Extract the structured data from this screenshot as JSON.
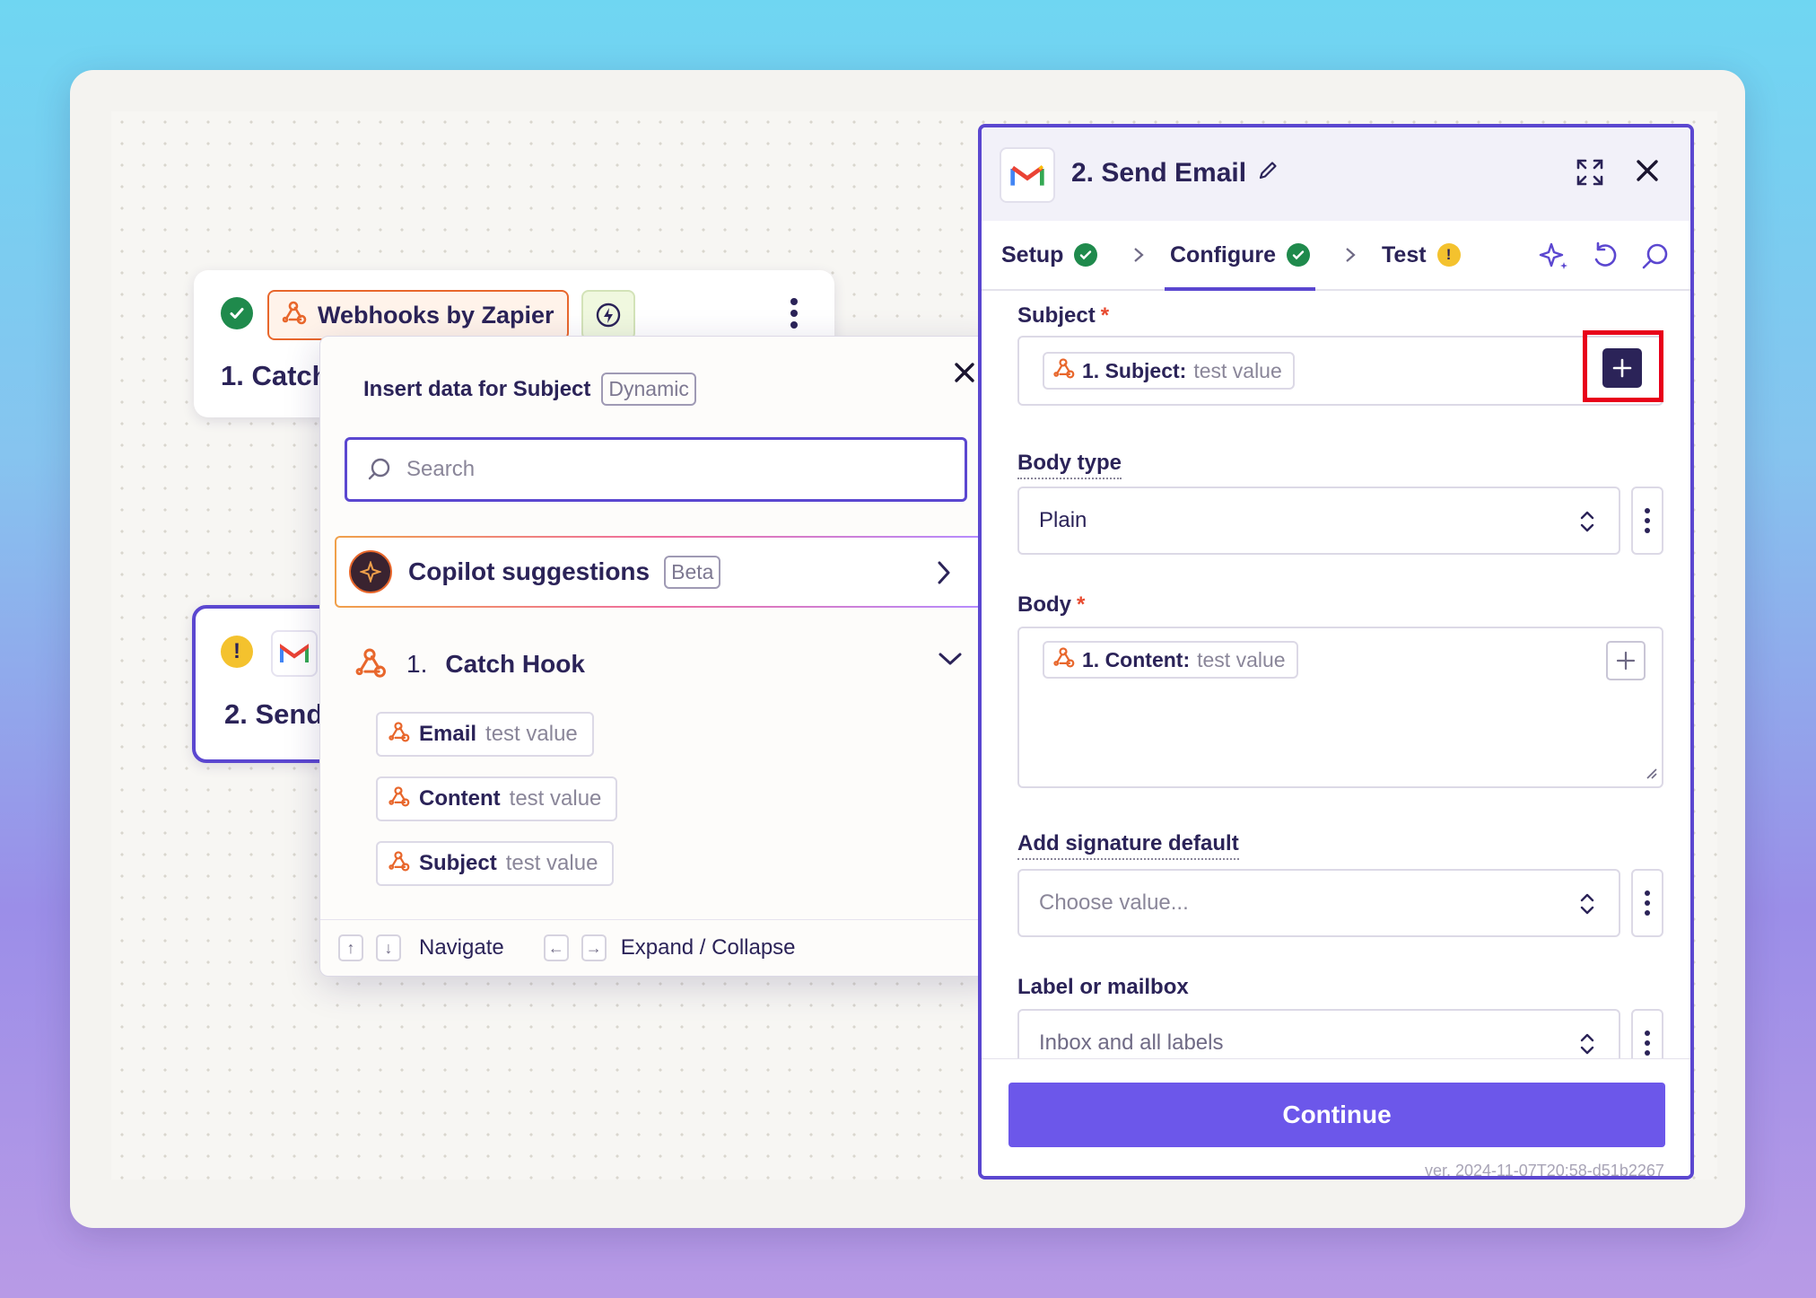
{
  "canvas": {
    "node1": {
      "app_name": "Webhooks by Zapier",
      "title": "1. Catch Hook"
    },
    "node2": {
      "title": "2. Send Email"
    }
  },
  "insert_popup": {
    "title": "Insert data for Subject",
    "badge": "Dynamic",
    "search_placeholder": "Search",
    "copilot": {
      "label": "Copilot suggestions",
      "badge": "Beta"
    },
    "section": {
      "number": "1.",
      "name": "Catch Hook"
    },
    "fields": [
      {
        "key": "Email",
        "value": "test value"
      },
      {
        "key": "Content",
        "value": "test value"
      },
      {
        "key": "Subject",
        "value": "test value"
      }
    ],
    "footer": {
      "navigate": "Navigate",
      "expand": "Expand / Collapse",
      "up": "↑",
      "down": "↓",
      "left": "←",
      "right": "→"
    }
  },
  "panel": {
    "title": "2. Send Email",
    "tabs": [
      {
        "label": "Setup",
        "status": "check"
      },
      {
        "label": "Configure",
        "status": "check",
        "active": true
      },
      {
        "label": "Test",
        "status": "warning"
      }
    ],
    "fields": {
      "subject": {
        "label": "Subject",
        "required": "*",
        "chip_key": "1. Subject:",
        "chip_value": "test value"
      },
      "body_type": {
        "label": "Body type",
        "value": "Plain"
      },
      "body": {
        "label": "Body",
        "required": "*",
        "chip_key": "1. Content:",
        "chip_value": "test value"
      },
      "signature": {
        "label": "Add signature default",
        "placeholder": "Choose value..."
      },
      "label_mailbox": {
        "label": "Label or mailbox",
        "value": "Inbox and all labels"
      }
    },
    "continue_label": "Continue",
    "version": "ver. 2024-11-07T20:58-d51b2267"
  },
  "colors": {
    "accent": "#5b47d0",
    "continue": "#6c57ea",
    "webhook": "#e8672c",
    "success": "#1f8a4c",
    "warning": "#f4c22e",
    "highlight": "#e8001a"
  }
}
